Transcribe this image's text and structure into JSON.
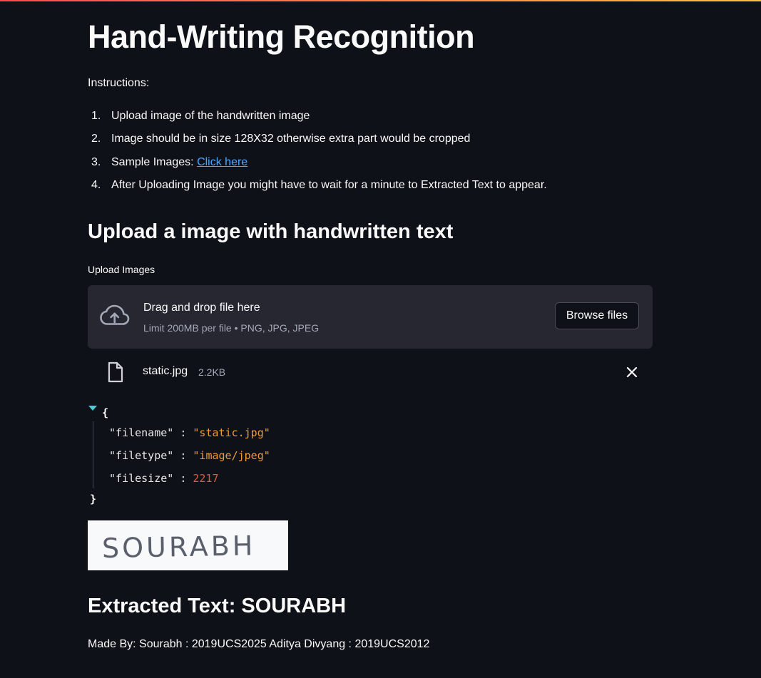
{
  "page": {
    "title": "Hand-Writing Recognition",
    "instructions_label": "Instructions:",
    "steps": [
      {
        "num": "1.",
        "text": "Upload image of the handwritten image",
        "link": ""
      },
      {
        "num": "2.",
        "text": "Image should be in size 128X32 otherwise extra part would be cropped",
        "link": ""
      },
      {
        "num": "3.",
        "text": "Sample Images: ",
        "link": "Click here"
      },
      {
        "num": "4.",
        "text": "After Uploading Image you might have to wait for a minute to Extracted Text to appear.",
        "link": ""
      }
    ],
    "upload_heading": "Upload a image with handwritten text"
  },
  "uploader": {
    "label": "Upload Images",
    "drop_title": "Drag and drop file here",
    "drop_limit": "Limit 200MB per file • PNG, JPG, JPEG",
    "browse_label": "Browse files",
    "icon": "cloud-upload-icon",
    "file": {
      "icon": "file-icon",
      "name": "static.jpg",
      "size": "2.2KB",
      "remove_icon": "close-icon"
    }
  },
  "json_view": {
    "open_brace": "{",
    "close_brace": "}",
    "rows": [
      {
        "key": "\"filename\"",
        "colon": " : ",
        "value": "\"static.jpg\"",
        "kind": "str"
      },
      {
        "key": "\"filetype\"",
        "colon": " : ",
        "value": "\"image/jpeg\"",
        "kind": "str"
      },
      {
        "key": "\"filesize\"",
        "colon": " : ",
        "value": "2217",
        "kind": "num"
      }
    ]
  },
  "handwriting_image": {
    "text": "SOURABH"
  },
  "result": {
    "heading": "Extracted Text: SOURABH"
  },
  "footer": {
    "credits": "Made By: Sourabh : 2019UCS2025 Aditya Divyang : 2019UCS2012"
  },
  "colors": {
    "background": "#0e1117",
    "dropzone": "#262730",
    "link": "#4ea6ff",
    "json_string": "#f09a3a",
    "json_number": "#e05a3a",
    "toggle": "#4ec9d4"
  }
}
